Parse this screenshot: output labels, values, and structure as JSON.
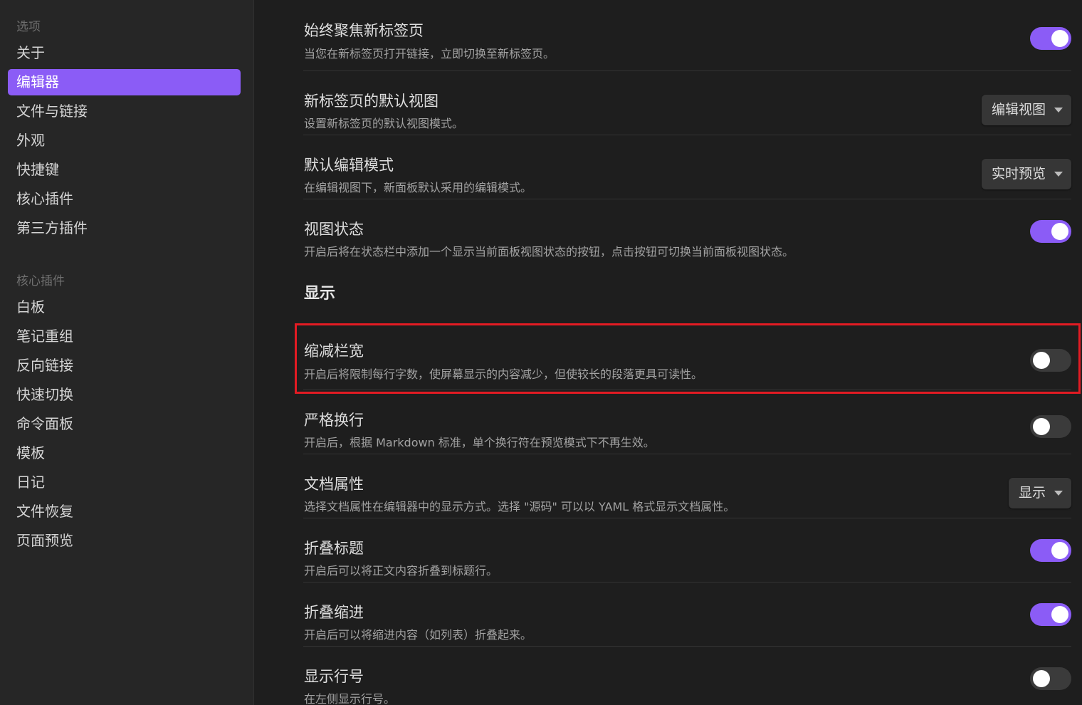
{
  "sidebar": {
    "group1_title": "选项",
    "group1": [
      "关于",
      "编辑器",
      "文件与链接",
      "外观",
      "快捷键",
      "核心插件",
      "第三方插件"
    ],
    "group2_title": "核心插件",
    "group2": [
      "白板",
      "笔记重组",
      "反向链接",
      "快速切换",
      "命令面板",
      "模板",
      "日记",
      "文件恢复",
      "页面预览"
    ]
  },
  "settings_top": [
    {
      "name": "始终聚焦新标签页",
      "desc": "当您在新标签页打开链接，立即切换至新标签页。",
      "control": "toggle",
      "on": true
    },
    {
      "name": "新标签页的默认视图",
      "desc": "设置新标签页的默认视图模式。",
      "control": "dropdown",
      "value": "编辑视图"
    },
    {
      "name": "默认编辑模式",
      "desc": "在编辑视图下，新面板默认采用的编辑模式。",
      "control": "dropdown",
      "value": "实时预览"
    },
    {
      "name": "视图状态",
      "desc": "开启后将在状态栏中添加一个显示当前面板视图状态的按钮，点击按钮可切换当前面板视图状态。",
      "control": "toggle",
      "on": true
    }
  ],
  "section_display": "显示",
  "settings_display": [
    {
      "name": "缩减栏宽",
      "desc": "开启后将限制每行字数，使屏幕显示的内容减少，但使较长的段落更具可读性。",
      "control": "toggle",
      "on": false
    },
    {
      "name": "严格换行",
      "desc": "开启后，根据 Markdown 标准，单个换行符在预览模式下不再生效。",
      "control": "toggle",
      "on": false
    },
    {
      "name": "文档属性",
      "desc": "选择文档属性在编辑器中的显示方式。选择 \"源码\" 可以以 YAML 格式显示文档属性。",
      "control": "dropdown",
      "value": "显示"
    },
    {
      "name": "折叠标题",
      "desc": "开启后可以将正文内容折叠到标题行。",
      "control": "toggle",
      "on": true
    },
    {
      "name": "折叠缩进",
      "desc": "开启后可以将缩进内容（如列表）折叠起来。",
      "control": "toggle",
      "on": true
    },
    {
      "name": "显示行号",
      "desc": "在左侧显示行号。",
      "control": "toggle",
      "on": false
    }
  ],
  "colors": {
    "accent": "#8b5cf6",
    "highlight": "#e31b23"
  }
}
